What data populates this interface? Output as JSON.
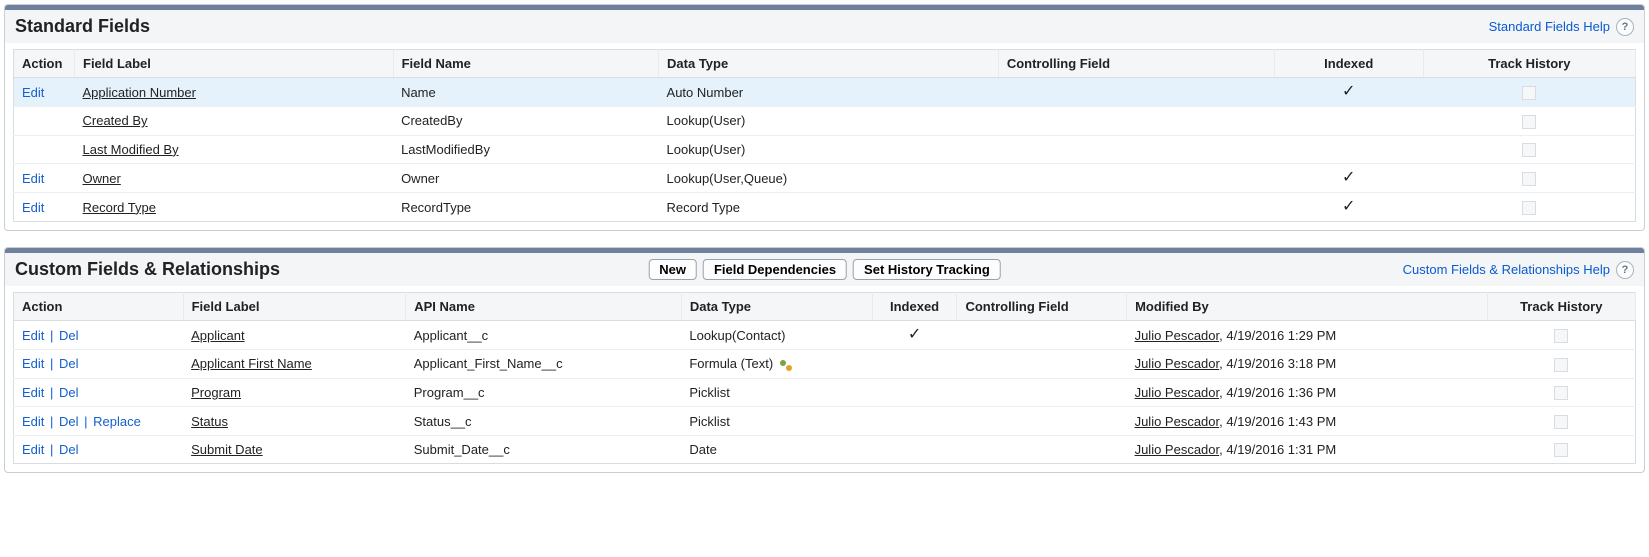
{
  "standard": {
    "title": "Standard Fields",
    "help_label": "Standard Fields Help",
    "columns": {
      "action": "Action",
      "field_label": "Field Label",
      "field_name": "Field Name",
      "data_type": "Data Type",
      "controlling_field": "Controlling Field",
      "indexed": "Indexed",
      "track_history": "Track History"
    },
    "edit_action": "Edit",
    "rows": [
      {
        "edit": true,
        "label": "Application Number",
        "name": "Name",
        "type": "Auto Number",
        "indexed": true,
        "highlight": true
      },
      {
        "edit": false,
        "label": "Created By",
        "name": "CreatedBy",
        "type": "Lookup(User)",
        "indexed": false
      },
      {
        "edit": false,
        "label": "Last Modified By",
        "name": "LastModifiedBy",
        "type": "Lookup(User)",
        "indexed": false
      },
      {
        "edit": true,
        "label": "Owner",
        "name": "Owner",
        "type": "Lookup(User,Queue)",
        "indexed": true
      },
      {
        "edit": true,
        "label": "Record Type",
        "name": "RecordType",
        "type": "Record Type",
        "indexed": true
      }
    ]
  },
  "custom": {
    "title": "Custom Fields & Relationships",
    "help_label": "Custom Fields & Relationships Help",
    "buttons": {
      "new": "New",
      "field_dependencies": "Field Dependencies",
      "set_history_tracking": "Set History Tracking"
    },
    "columns": {
      "action": "Action",
      "field_label": "Field Label",
      "api_name": "API Name",
      "data_type": "Data Type",
      "indexed": "Indexed",
      "controlling_field": "Controlling Field",
      "modified_by": "Modified By",
      "track_history": "Track History"
    },
    "actions": {
      "edit": "Edit",
      "del": "Del",
      "replace": "Replace"
    },
    "rows": [
      {
        "actions": [
          "edit",
          "del"
        ],
        "label": "Applicant",
        "api": "Applicant__c",
        "type": "Lookup(Contact)",
        "indexed": true,
        "mod_name": "Julio Pescador",
        "mod_ts": "4/19/2016 1:29 PM"
      },
      {
        "actions": [
          "edit",
          "del"
        ],
        "label": "Applicant First Name",
        "api": "Applicant_First_Name__c",
        "type": "Formula (Text)",
        "icon": true,
        "mod_name": "Julio Pescador",
        "mod_ts": "4/19/2016 3:18 PM"
      },
      {
        "actions": [
          "edit",
          "del"
        ],
        "label": "Program",
        "api": "Program__c",
        "type": "Picklist",
        "mod_name": "Julio Pescador",
        "mod_ts": "4/19/2016 1:36 PM"
      },
      {
        "actions": [
          "edit",
          "del",
          "replace"
        ],
        "label": "Status",
        "api": "Status__c",
        "type": "Picklist",
        "mod_name": "Julio Pescador",
        "mod_ts": "4/19/2016 1:43 PM"
      },
      {
        "actions": [
          "edit",
          "del"
        ],
        "label": "Submit Date",
        "api": "Submit_Date__c",
        "type": "Date",
        "mod_name": "Julio Pescador",
        "mod_ts": "4/19/2016 1:31 PM"
      }
    ]
  }
}
